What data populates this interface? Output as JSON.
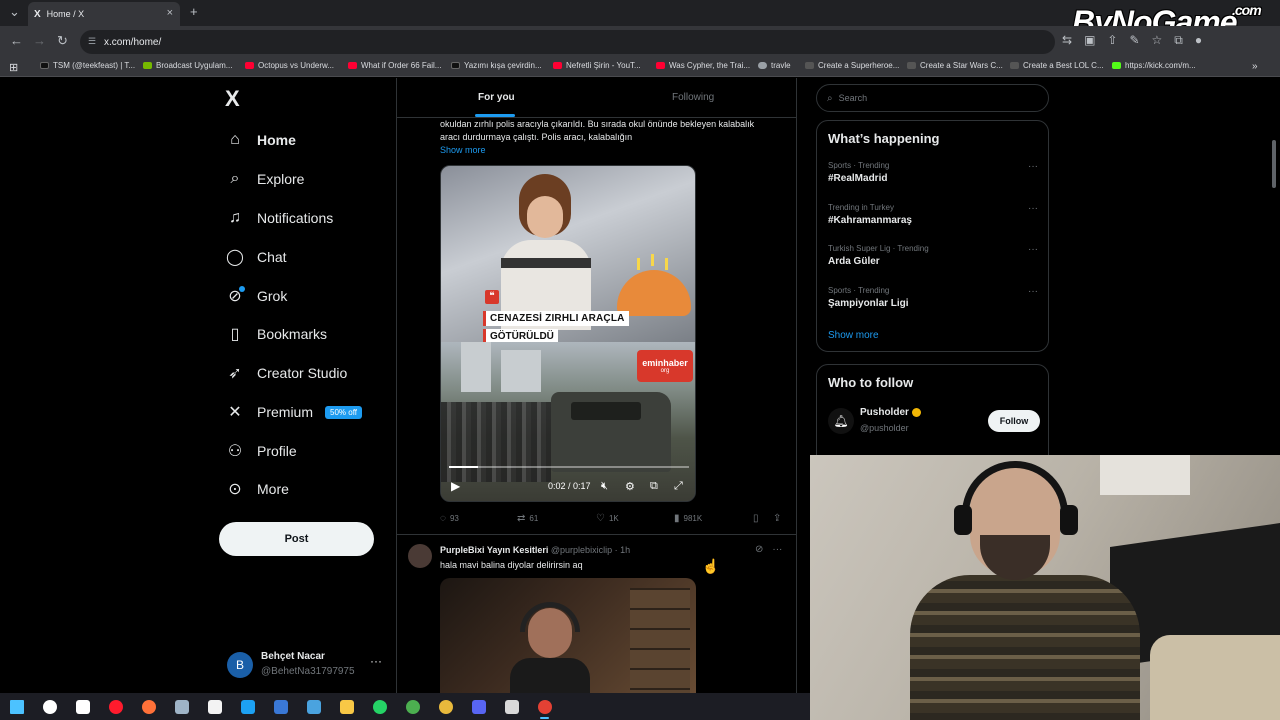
{
  "browser": {
    "tab_title": "Home / X",
    "tab_logo": "X",
    "url": "x.com/home/",
    "bookmarks": [
      {
        "label": "TSM (@teekfeast) | T...",
        "color": "#111111"
      },
      {
        "label": "Broadcast Uygulam...",
        "color": "#76b900"
      },
      {
        "label": "Octopus vs Underw...",
        "color": "#ff0033"
      },
      {
        "label": "What if Order 66 Fail...",
        "color": "#ff0033"
      },
      {
        "label": "Yazımı kışa çevirdin...",
        "color": "#111111"
      },
      {
        "label": "Nefretli Şirin - YouT...",
        "color": "#ff0033"
      },
      {
        "label": "Was Cypher, the Trai...",
        "color": "#ff0033"
      },
      {
        "label": "travle",
        "color": "#9aa0a6"
      },
      {
        "label": "Create a Superheroe...",
        "color": "#444444"
      },
      {
        "label": "Create a Star Wars C...",
        "color": "#444444"
      },
      {
        "label": "Create a Best LOL C...",
        "color": "#444444"
      },
      {
        "label": "https://kick.com/m...",
        "color": "#53fc18"
      }
    ]
  },
  "watermark": {
    "text": "ByNoGame",
    "suffix": ".com"
  },
  "sidebar": {
    "logo": "X",
    "items": [
      {
        "label": "Home",
        "icon": "home-icon",
        "glyph": "⌂"
      },
      {
        "label": "Explore",
        "icon": "search-icon",
        "glyph": "⌕"
      },
      {
        "label": "Notifications",
        "icon": "bell-icon",
        "glyph": "♫"
      },
      {
        "label": "Chat",
        "icon": "chat-icon",
        "glyph": "◯"
      },
      {
        "label": "Grok",
        "icon": "grok-icon",
        "glyph": "⊘"
      },
      {
        "label": "Bookmarks",
        "icon": "bookmark-icon",
        "glyph": "▯"
      },
      {
        "label": "Creator Studio",
        "icon": "rocket-icon",
        "glyph": "➶"
      },
      {
        "label": "Premium",
        "icon": "x-premium-icon",
        "glyph": "✕"
      },
      {
        "label": "Profile",
        "icon": "profile-icon",
        "glyph": "⚇"
      },
      {
        "label": "More",
        "icon": "more-icon",
        "glyph": "⊙"
      }
    ],
    "premium_badge": "50% off",
    "post_label": "Post",
    "account": {
      "initial": "B",
      "name": "Behçet Nacar",
      "handle": "@BehetNa31797975",
      "menu": "···"
    }
  },
  "feed": {
    "tabs": [
      {
        "label": "For you"
      },
      {
        "label": "Following"
      }
    ],
    "tweet1": {
      "text_line1": "okuldan zırhlı polis aracıyla çıkarıldı. Bu sırada okul önünde bekleyen kalabalık",
      "text_line2": "aracı durdurmaya çalıştı. Polis aracı, kalabalığın",
      "show_more": "Show more",
      "headline1": "CENAZESİ ZIRHLI ARAÇLA",
      "headline2": "GÖTÜRÜLDÜ",
      "quote_glyph": "❝",
      "brand": "eminhaber",
      "brand_sub": "org",
      "video_time": "0:02 / 0:17",
      "video_progress": 0.12,
      "replies": "93",
      "reposts": "61",
      "likes": "1K",
      "views": "981K"
    },
    "tweet2": {
      "name": "PurpleBixi Yayın Kesitleri",
      "handle": "@purplebixiclip",
      "time": "1h",
      "text": "hala mavi balina diyolar delirirsin aq"
    }
  },
  "right": {
    "search_placeholder": "Search",
    "happening_title": "What’s happening",
    "trends": [
      {
        "context": "Sports · Trending",
        "name": "#RealMadrid"
      },
      {
        "context": "Trending in Turkey",
        "name": "#Kahramanmaraş"
      },
      {
        "context": "Turkish Super Lig · Trending",
        "name": "Arda Güler"
      },
      {
        "context": "Sports · Trending",
        "name": "Şampiyonlar Ligi"
      }
    ],
    "show_more": "Show more",
    "wtf_title": "Who to follow",
    "wtf": [
      {
        "name": "Pusholder",
        "handle": "@pusholder",
        "button": "Follow"
      }
    ]
  },
  "taskbar": {
    "icons": [
      {
        "name": "windows-start-icon",
        "color": "#4cc2ff"
      },
      {
        "name": "search-icon",
        "color": "#ffffff"
      },
      {
        "name": "task-view-icon",
        "color": "#ffffff"
      },
      {
        "name": "opera-icon",
        "color": "#ff1b2d"
      },
      {
        "name": "firefox-icon",
        "color": "#ff7139"
      },
      {
        "name": "app-icon",
        "color": "#9fb4c7"
      },
      {
        "name": "store-icon",
        "color": "#f3f3f3"
      },
      {
        "name": "edge-icon",
        "color": "#1da1f2"
      },
      {
        "name": "display-icon",
        "color": "#3a78d6"
      },
      {
        "name": "terminal-icon",
        "color": "#4aa3df"
      },
      {
        "name": "folder-icon",
        "color": "#f8c846"
      },
      {
        "name": "whatsapp-icon",
        "color": "#25d366"
      },
      {
        "name": "chrome-icon",
        "color": "#4caf50"
      },
      {
        "name": "chrome-profile-icon",
        "color": "#e8b93c"
      },
      {
        "name": "discord-icon",
        "color": "#5865f2"
      },
      {
        "name": "obs-icon",
        "color": "#d9d9d9"
      },
      {
        "name": "chrome-active-icon",
        "color": "#e44134"
      }
    ]
  }
}
